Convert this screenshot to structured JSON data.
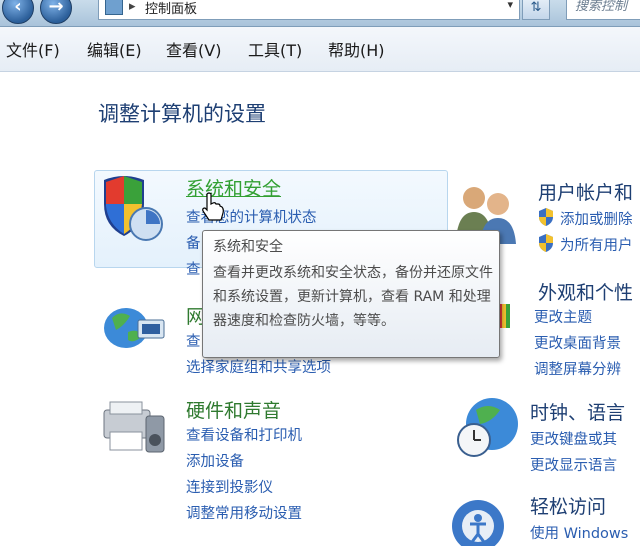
{
  "address_bar": {
    "path": "控制面板",
    "search_placeholder": "搜索控制"
  },
  "menu": {
    "items": [
      "文件(F)",
      "编辑(E)",
      "查看(V)",
      "工具(T)",
      "帮助(H)"
    ]
  },
  "page_title": "调整计算机的设置",
  "categories": {
    "system_security": {
      "title": "系统和安全",
      "links": [
        "查看您的计算机状态",
        "备",
        "查"
      ]
    },
    "network": {
      "title": "网",
      "links": [
        "查",
        "选择家庭组和共享选项"
      ]
    },
    "hardware_sound": {
      "title": "硬件和声音",
      "links": [
        "查看设备和打印机",
        "添加设备",
        "连接到投影仪",
        "调整常用移动设置"
      ]
    },
    "user_accounts": {
      "title": "用户帐户和",
      "links": [
        "添加或删除",
        "为所有用户"
      ]
    },
    "appearance": {
      "title": "外观和个性",
      "links": [
        "更改主题",
        "更改桌面背景",
        "调整屏幕分辨"
      ]
    },
    "clock_language": {
      "title": "时钟、语言",
      "links": [
        "更改键盘或其",
        "更改显示语言"
      ]
    },
    "ease_of_access": {
      "title": "轻松访问",
      "links": [
        "使用 Windows"
      ]
    }
  },
  "tooltip": {
    "title": "系统和安全",
    "body": "查看并更改系统和安全状态，备份并还原文件和系统设置，更新计算机，查看 RAM 和处理器速度和检查防火墙，等等。"
  },
  "colors": {
    "category_title": "#2f7a2f",
    "link": "#2a5db0",
    "heading": "#1e3f73"
  }
}
